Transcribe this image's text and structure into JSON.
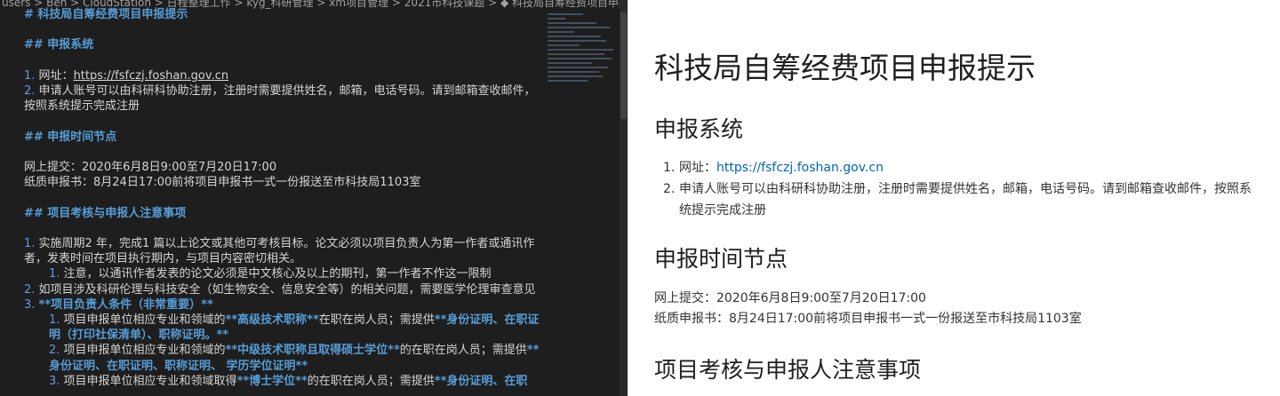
{
  "breadcrumb": "users > Ben > CloudStation > 日程整理工作 > kyg_科研管理 > xm项目管理 > 2021市科技课题 > ◆ 科技局自筹经费项目申报提示.md",
  "editor": {
    "lines": [
      {
        "cls": "head",
        "text": "# 科技局自筹经费项目申报提示"
      },
      {
        "cls": "",
        "text": ""
      },
      {
        "cls": "head",
        "text": "## 申报系统"
      },
      {
        "cls": "",
        "text": ""
      },
      {
        "cls": "list1",
        "num": "1. ",
        "pre": "网址：",
        "link": "https://fsfczj.foshan.gov.cn"
      },
      {
        "cls": "list2",
        "num": "2. ",
        "text": "申请人账号可以由科研科协助注册，注册时需要提供姓名，邮箱，电话号码。请到邮箱查收邮件，按照系统提示完成注册"
      },
      {
        "cls": "",
        "text": ""
      },
      {
        "cls": "head",
        "text": "## 申报时间节点"
      },
      {
        "cls": "",
        "text": ""
      },
      {
        "cls": "",
        "text": "网上提交：2020年6月8日9:00至7月20日17:00"
      },
      {
        "cls": "",
        "text": "纸质申报书：8月24日17:00前将项目申报书一式一份报送至市科技局1103室"
      },
      {
        "cls": "",
        "text": ""
      },
      {
        "cls": "head",
        "text": "## 项目考核与申报人注意事项"
      },
      {
        "cls": "",
        "text": ""
      },
      {
        "cls": "list2",
        "num": "1. ",
        "text": "实施周期2 年，完成1 篇以上论文或其他可考核目标。论文必须以项目负责人为第一作者或通讯作者，发表时间在项目执行期内，与项目内容密切相关。"
      },
      {
        "cls": "sub",
        "num": "1. ",
        "text": "注意，以通讯作者发表的论文必须是中文核心及以上的期刊，第一作者不作这一限制"
      },
      {
        "cls": "list2",
        "num": "2. ",
        "text": "如项目涉及科研伦理与科技安全（如生物安全、信息安全等）的相关问题，需要医学伦理审查意见"
      },
      {
        "cls": "boldline",
        "num": "3. ",
        "text": "**项目负责人条件（非常重要）**"
      },
      {
        "cls": "sub",
        "num": "1. ",
        "pre": "项目申报单位相应专业和领域的",
        "b1": "**高级技术职称**",
        "mid": "在职在岗人员；需提供",
        "b2": "**身份证明、在职证明（打印社保清单）、职称证明。**"
      },
      {
        "cls": "sub",
        "num": "2. ",
        "pre": "项目申报单位相应专业和领域的",
        "b1": "**中级技术职称且取得硕士学位**",
        "mid": "的在职在岗人员；需提供",
        "b2": "**身份证明、在职证明、职称证明、 学历学位证明**"
      },
      {
        "cls": "sub",
        "num": "3. ",
        "pre": "项目申报单位相应专业和领域取得",
        "b1": "**博士学位**",
        "mid": "的在职在岗人员；需提供",
        "b2": "**身份证明、在职"
      }
    ]
  },
  "preview": {
    "title": "科技局自筹经费项目申报提示",
    "sec1": "申报系统",
    "item1_label": "网址：",
    "item1_link": "https://fsfczj.foshan.gov.cn",
    "item2": "申请人账号可以由科研科协助注册，注册时需要提供姓名，邮箱，电话号码。请到邮箱查收邮件，按照系统提示完成注册",
    "sec2": "申报时间节点",
    "online": "网上提交：2020年6月8日9:00至7月20日17:00",
    "paper": "纸质申报书：8月24日17:00前将项目申报书一式一份报送至市科技局1103室",
    "sec3": "项目考核与申报人注意事项",
    "n1": "1.",
    "n2": "2."
  }
}
